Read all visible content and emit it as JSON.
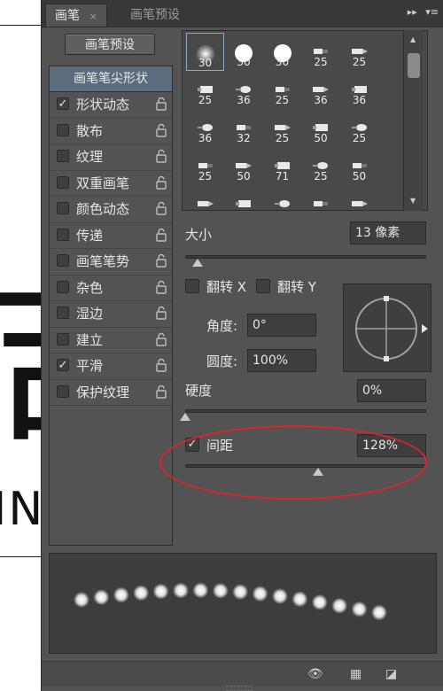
{
  "document": {
    "big_glyph": "吉",
    "letters": "IN"
  },
  "tabs": [
    {
      "label": "画笔",
      "close": "×"
    },
    {
      "label": "画笔预设"
    }
  ],
  "tab_menu_icons": [
    "▸▸",
    "▾≡"
  ],
  "preset_button": "画笔预设",
  "left_list": {
    "header": "画笔笔尖形状",
    "items": [
      {
        "label": "形状动态",
        "checked": true,
        "mark": "✓"
      },
      {
        "label": "散布",
        "checked": false,
        "mark": ""
      },
      {
        "label": "纹理",
        "checked": false,
        "mark": ""
      },
      {
        "label": "双重画笔",
        "checked": false,
        "mark": ""
      },
      {
        "label": "颜色动态",
        "checked": false,
        "mark": ""
      },
      {
        "label": "传递",
        "checked": false,
        "mark": ""
      },
      {
        "label": "画笔笔势",
        "checked": false,
        "mark": ""
      },
      {
        "label": "杂色",
        "checked": false,
        "mark": ""
      },
      {
        "label": "湿边",
        "checked": false,
        "mark": ""
      },
      {
        "label": "建立",
        "checked": false,
        "mark": ""
      },
      {
        "label": "平滑",
        "checked": true,
        "mark": "✓"
      },
      {
        "label": "保护纹理",
        "checked": false,
        "mark": ""
      }
    ]
  },
  "brush_tips": [
    [
      "30",
      "30",
      "30",
      "25",
      "25"
    ],
    [
      "25",
      "36",
      "25",
      "36",
      "36"
    ],
    [
      "36",
      "32",
      "25",
      "50",
      "25"
    ],
    [
      "25",
      "50",
      "71",
      "25",
      "50"
    ],
    [
      "",
      "",
      "",
      "",
      ""
    ]
  ],
  "selected_tip_size": "30",
  "size": {
    "label": "大小",
    "value": "13 像素",
    "level": 0.05
  },
  "flip": {
    "label_x": "翻转 X",
    "label_y": "翻转 Y"
  },
  "angle": {
    "label": "角度:",
    "value": "0°"
  },
  "roundness": {
    "label": "圆度:",
    "value": "100%"
  },
  "hardness": {
    "label": "硬度",
    "value": "0%",
    "level": 0.0
  },
  "spacing": {
    "label": "间距",
    "value": "128%",
    "checked": true,
    "mark": "✓",
    "level": 0.55
  },
  "colors": {
    "panel": "#535353",
    "highlight_header": "#5c6b7e",
    "annotation_red": "#d9262b"
  }
}
